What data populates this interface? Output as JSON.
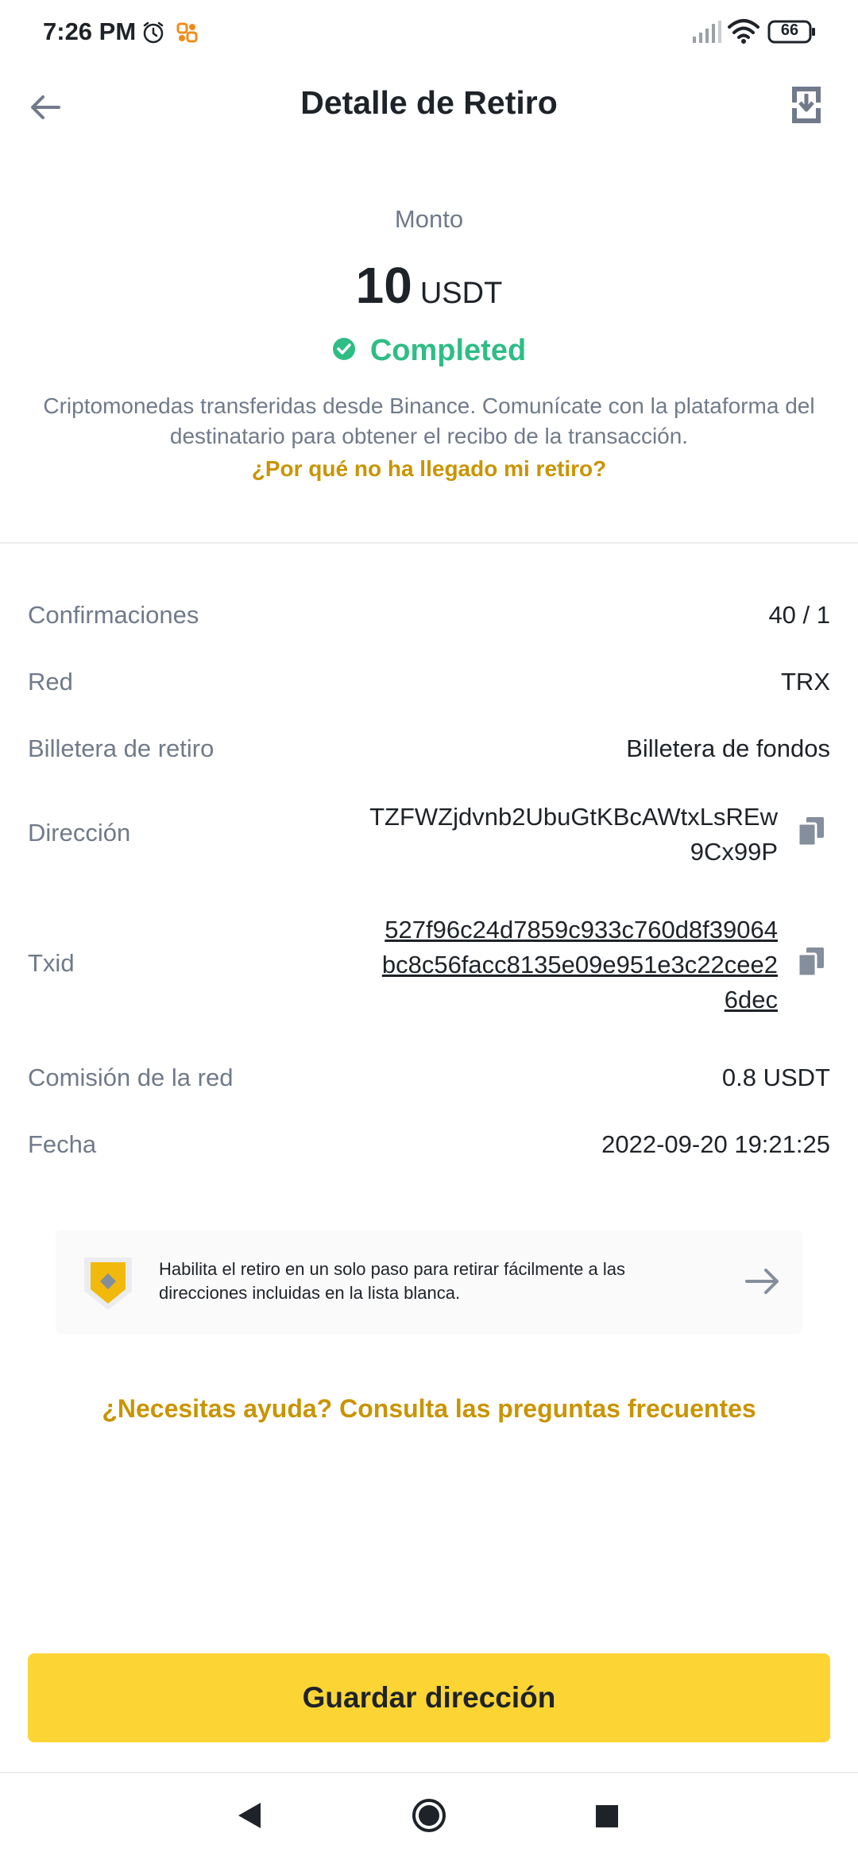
{
  "status_bar": {
    "time": "7:26 PM",
    "battery": "66",
    "icons": [
      "alarm-icon",
      "app-notification-icon",
      "signal-icon",
      "wifi-icon",
      "battery-icon"
    ]
  },
  "header": {
    "title": "Detalle de Retiro",
    "back_icon": "arrow-left-icon",
    "action_icon": "download-icon"
  },
  "amount": {
    "label": "Monto",
    "value": "10",
    "unit": "USDT",
    "status": "Completed",
    "status_color": "#2ebd85",
    "info": "Criptomonedas transferidas desde Binance. Comunícate con la plataforma del destinatario para obtener el recibo de la transacción.",
    "why_link": "¿Por qué no ha llegado mi retiro?"
  },
  "details": {
    "confirmations": {
      "label": "Confirmaciones",
      "value": "40 / 1"
    },
    "network": {
      "label": "Red",
      "value": "TRX"
    },
    "wallet": {
      "label": "Billetera de retiro",
      "value": "Billetera de fondos"
    },
    "address": {
      "label": "Dirección",
      "value": "TZFWZjdvnb2UbuGtKBcAWtxLsREw9Cx99P"
    },
    "txid": {
      "label": "Txid",
      "value": "527f96c24d7859c933c760d8f39064bc8c56facc8135e09e951e3c22cee26dec"
    },
    "fee": {
      "label": "Comisión de la red",
      "value": "0.8 USDT"
    },
    "date": {
      "label": "Fecha",
      "value": "2022-09-20 19:21:25"
    }
  },
  "promo": {
    "text": "Habilita el retiro en un solo paso para retirar fácilmente a las direcciones incluidas en la lista blanca.",
    "icon": "shield-icon"
  },
  "help_link": "¿Necesitas ayuda? Consulta las preguntas frecuentes",
  "save_button": "Guardar dirección",
  "colors": {
    "accent": "#fcd535",
    "link": "#c99400",
    "text_primary": "#1e2329",
    "text_secondary": "#707a8a",
    "success": "#2ebd85"
  }
}
